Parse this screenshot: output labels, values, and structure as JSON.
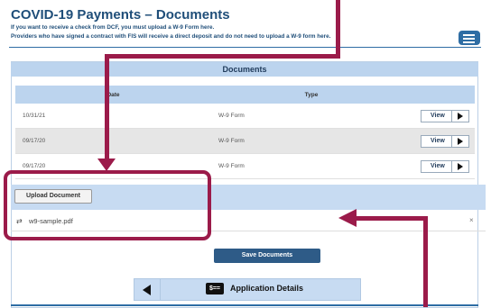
{
  "header": {
    "title": "COVID-19 Payments – Documents",
    "line1": "If you want to receive a check from DCF, you must upload a W-9 Form here.",
    "line2": "Providers who have signed a contract with FIS will receive a direct deposit and do not need to upload a W-9 form here."
  },
  "documents": {
    "heading": "Documents",
    "columns": [
      "Date",
      "Type",
      ""
    ],
    "rows": [
      {
        "date": "10/31/21",
        "type": "W-9 Form",
        "action": "View"
      },
      {
        "date": "09/17/20",
        "type": "W-9 Form",
        "action": "View"
      },
      {
        "date": "09/17/20",
        "type": "W-9 Form",
        "action": "View"
      }
    ]
  },
  "upload": {
    "button_label": "Upload Document",
    "file_name": "w9-sample.pdf",
    "remove_glyph": "×"
  },
  "actions": {
    "save_label": "Save Documents"
  },
  "nav": {
    "label": "Application Details",
    "icon": "$=="
  },
  "colors": {
    "annotation": "#9b1b4a",
    "primary": "#2e5b87",
    "header_blue": "#1f4e79"
  }
}
